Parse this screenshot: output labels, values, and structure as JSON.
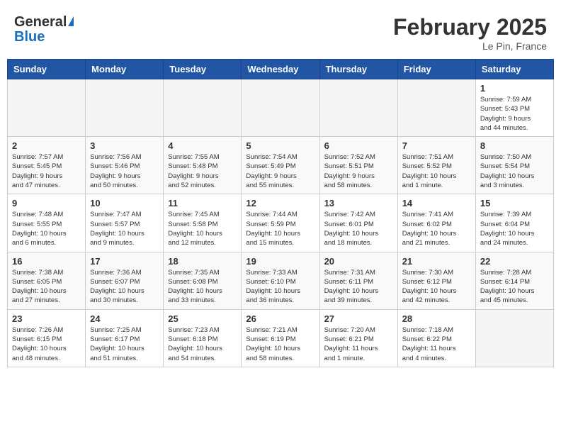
{
  "header": {
    "logo_general": "General",
    "logo_blue": "Blue",
    "month_title": "February 2025",
    "location": "Le Pin, France"
  },
  "weekdays": [
    "Sunday",
    "Monday",
    "Tuesday",
    "Wednesday",
    "Thursday",
    "Friday",
    "Saturday"
  ],
  "weeks": [
    {
      "days": [
        {
          "num": "",
          "info": ""
        },
        {
          "num": "",
          "info": ""
        },
        {
          "num": "",
          "info": ""
        },
        {
          "num": "",
          "info": ""
        },
        {
          "num": "",
          "info": ""
        },
        {
          "num": "",
          "info": ""
        },
        {
          "num": "1",
          "info": "Sunrise: 7:59 AM\nSunset: 5:43 PM\nDaylight: 9 hours\nand 44 minutes."
        }
      ]
    },
    {
      "days": [
        {
          "num": "2",
          "info": "Sunrise: 7:57 AM\nSunset: 5:45 PM\nDaylight: 9 hours\nand 47 minutes."
        },
        {
          "num": "3",
          "info": "Sunrise: 7:56 AM\nSunset: 5:46 PM\nDaylight: 9 hours\nand 50 minutes."
        },
        {
          "num": "4",
          "info": "Sunrise: 7:55 AM\nSunset: 5:48 PM\nDaylight: 9 hours\nand 52 minutes."
        },
        {
          "num": "5",
          "info": "Sunrise: 7:54 AM\nSunset: 5:49 PM\nDaylight: 9 hours\nand 55 minutes."
        },
        {
          "num": "6",
          "info": "Sunrise: 7:52 AM\nSunset: 5:51 PM\nDaylight: 9 hours\nand 58 minutes."
        },
        {
          "num": "7",
          "info": "Sunrise: 7:51 AM\nSunset: 5:52 PM\nDaylight: 10 hours\nand 1 minute."
        },
        {
          "num": "8",
          "info": "Sunrise: 7:50 AM\nSunset: 5:54 PM\nDaylight: 10 hours\nand 3 minutes."
        }
      ]
    },
    {
      "days": [
        {
          "num": "9",
          "info": "Sunrise: 7:48 AM\nSunset: 5:55 PM\nDaylight: 10 hours\nand 6 minutes."
        },
        {
          "num": "10",
          "info": "Sunrise: 7:47 AM\nSunset: 5:57 PM\nDaylight: 10 hours\nand 9 minutes."
        },
        {
          "num": "11",
          "info": "Sunrise: 7:45 AM\nSunset: 5:58 PM\nDaylight: 10 hours\nand 12 minutes."
        },
        {
          "num": "12",
          "info": "Sunrise: 7:44 AM\nSunset: 5:59 PM\nDaylight: 10 hours\nand 15 minutes."
        },
        {
          "num": "13",
          "info": "Sunrise: 7:42 AM\nSunset: 6:01 PM\nDaylight: 10 hours\nand 18 minutes."
        },
        {
          "num": "14",
          "info": "Sunrise: 7:41 AM\nSunset: 6:02 PM\nDaylight: 10 hours\nand 21 minutes."
        },
        {
          "num": "15",
          "info": "Sunrise: 7:39 AM\nSunset: 6:04 PM\nDaylight: 10 hours\nand 24 minutes."
        }
      ]
    },
    {
      "days": [
        {
          "num": "16",
          "info": "Sunrise: 7:38 AM\nSunset: 6:05 PM\nDaylight: 10 hours\nand 27 minutes."
        },
        {
          "num": "17",
          "info": "Sunrise: 7:36 AM\nSunset: 6:07 PM\nDaylight: 10 hours\nand 30 minutes."
        },
        {
          "num": "18",
          "info": "Sunrise: 7:35 AM\nSunset: 6:08 PM\nDaylight: 10 hours\nand 33 minutes."
        },
        {
          "num": "19",
          "info": "Sunrise: 7:33 AM\nSunset: 6:10 PM\nDaylight: 10 hours\nand 36 minutes."
        },
        {
          "num": "20",
          "info": "Sunrise: 7:31 AM\nSunset: 6:11 PM\nDaylight: 10 hours\nand 39 minutes."
        },
        {
          "num": "21",
          "info": "Sunrise: 7:30 AM\nSunset: 6:12 PM\nDaylight: 10 hours\nand 42 minutes."
        },
        {
          "num": "22",
          "info": "Sunrise: 7:28 AM\nSunset: 6:14 PM\nDaylight: 10 hours\nand 45 minutes."
        }
      ]
    },
    {
      "days": [
        {
          "num": "23",
          "info": "Sunrise: 7:26 AM\nSunset: 6:15 PM\nDaylight: 10 hours\nand 48 minutes."
        },
        {
          "num": "24",
          "info": "Sunrise: 7:25 AM\nSunset: 6:17 PM\nDaylight: 10 hours\nand 51 minutes."
        },
        {
          "num": "25",
          "info": "Sunrise: 7:23 AM\nSunset: 6:18 PM\nDaylight: 10 hours\nand 54 minutes."
        },
        {
          "num": "26",
          "info": "Sunrise: 7:21 AM\nSunset: 6:19 PM\nDaylight: 10 hours\nand 58 minutes."
        },
        {
          "num": "27",
          "info": "Sunrise: 7:20 AM\nSunset: 6:21 PM\nDaylight: 11 hours\nand 1 minute."
        },
        {
          "num": "28",
          "info": "Sunrise: 7:18 AM\nSunset: 6:22 PM\nDaylight: 11 hours\nand 4 minutes."
        },
        {
          "num": "",
          "info": ""
        }
      ]
    }
  ]
}
